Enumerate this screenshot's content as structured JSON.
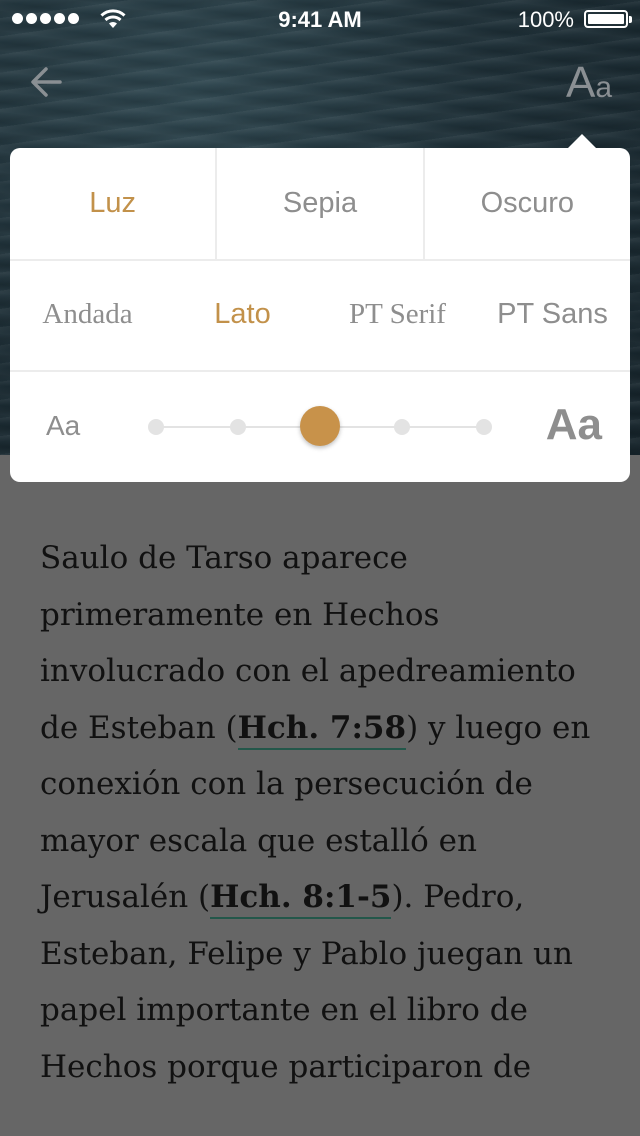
{
  "status_bar": {
    "time": "9:41 AM",
    "battery": "100%"
  },
  "header": {
    "settings_label_big": "A",
    "settings_label_small": "a"
  },
  "popover": {
    "themes": [
      {
        "label": "Luz",
        "selected": true
      },
      {
        "label": "Sepia",
        "selected": false
      },
      {
        "label": "Oscuro",
        "selected": false
      }
    ],
    "fonts": [
      {
        "label": "Andada",
        "selected": false
      },
      {
        "label": "Lato",
        "selected": true
      },
      {
        "label": "PT Serif",
        "selected": false
      },
      {
        "label": "PT Sans",
        "selected": false
      }
    ],
    "size": {
      "small_label": "Aa",
      "large_label": "Aa",
      "steps": 5,
      "selected_step": 3
    }
  },
  "article": {
    "p1_a": "Saulo de Tarso aparece primeramente en Hechos involucrado con el apedreamiento de Esteban (",
    "ref1": "Hch. 7:58",
    "p1_b": ") y luego en conexión con la persecución de mayor escala que estalló en Jerusalén (",
    "ref2": "Hch. 8:1-5",
    "p1_c": "). Pedro, Esteban, Felipe y Pablo juegan un papel importante en el libro de Hechos porque participaron de"
  },
  "colors": {
    "accent": "#c2914a",
    "link_underline": "#23574a"
  }
}
